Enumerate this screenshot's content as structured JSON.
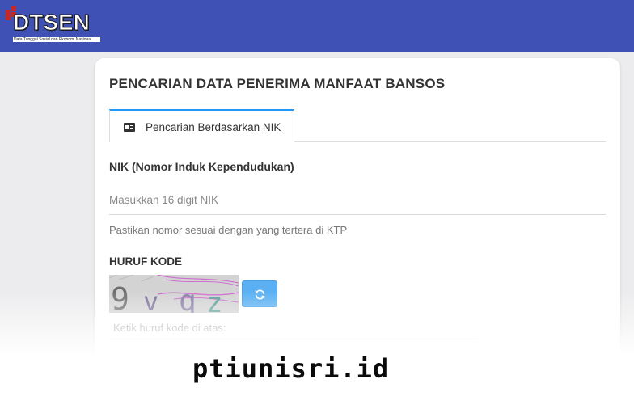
{
  "header": {
    "logo_text": "DTSEN",
    "logo_subtitle": "Data Tunggal Sosial dan Ekonomi Nasional",
    "brand_color": "#3f51b5",
    "logo_accent_color": "#c62828"
  },
  "page": {
    "title": "PENCARIAN DATA PENERIMA MANFAAT BANSOS"
  },
  "tabs": [
    {
      "label": "Pencarian Berdasarkan NIK",
      "icon": "id-card-icon",
      "active": true
    }
  ],
  "form": {
    "nik_label": "NIK (Nomor Induk Kependudukan)",
    "nik_placeholder": "Masukkan 16 digit NIK",
    "nik_value": "",
    "nik_help": "Pastikan nomor sesuai dengan yang tertera di KTP",
    "captcha_label": "HURUF KODE",
    "captcha_text": "9vqz",
    "captcha_placeholder": "Ketik huruf kode di atas:",
    "captcha_value": "",
    "refresh_icon": "refresh-icon",
    "refresh_button_color": "#5ab0f2"
  },
  "watermark": {
    "text": "ptiunisri.id"
  }
}
